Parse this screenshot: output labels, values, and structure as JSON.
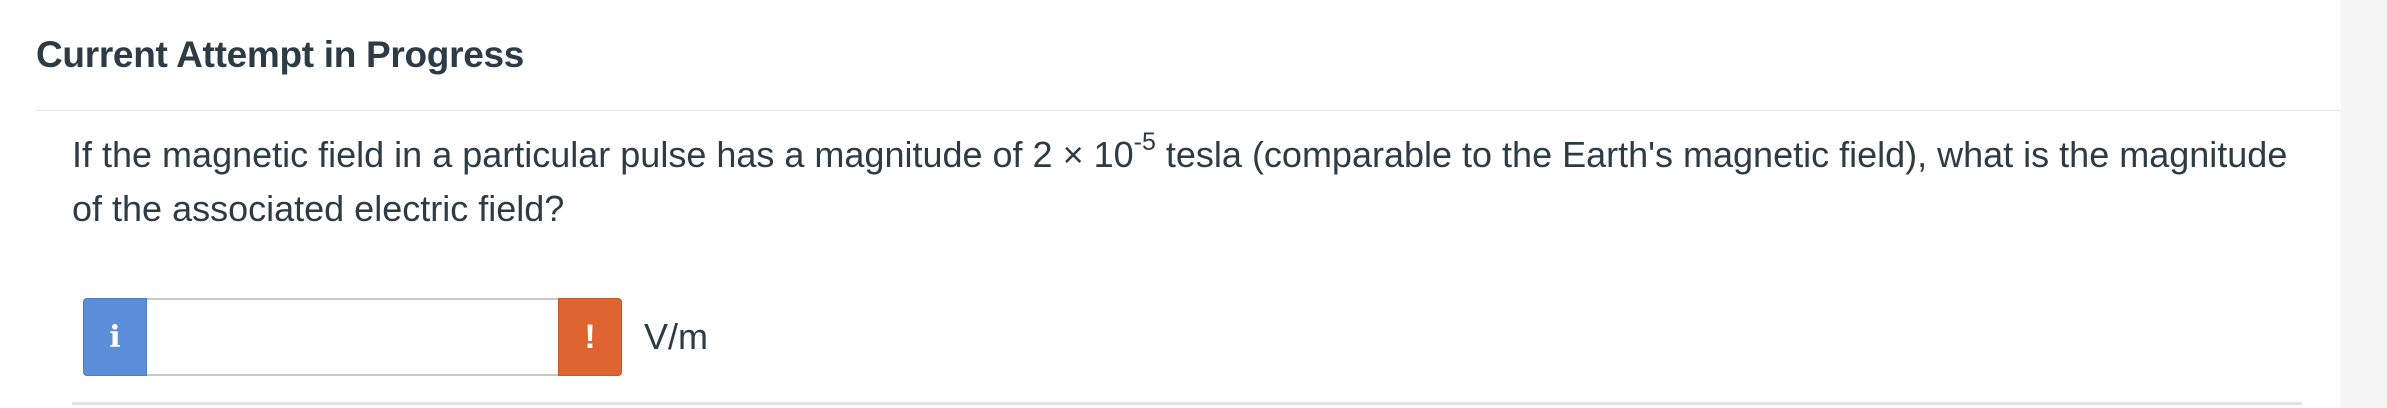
{
  "header": {
    "title": "Current Attempt in Progress"
  },
  "question": {
    "text_before": "If the magnetic field in a particular pulse has a magnitude of 2 × 10",
    "exponent": "-5",
    "text_after": " tesla (comparable to the Earth's magnetic field), what is the magnitude of the associated electric field?"
  },
  "answer": {
    "info_icon": "info-icon",
    "info_glyph": "i",
    "input_value": "",
    "input_placeholder": "",
    "warning_icon": "exclamation-icon",
    "warning_glyph": "!",
    "unit": "V/m"
  },
  "colors": {
    "info_button": "#5b8dd9",
    "warning_button": "#de6532",
    "text": "#2d3b45"
  }
}
